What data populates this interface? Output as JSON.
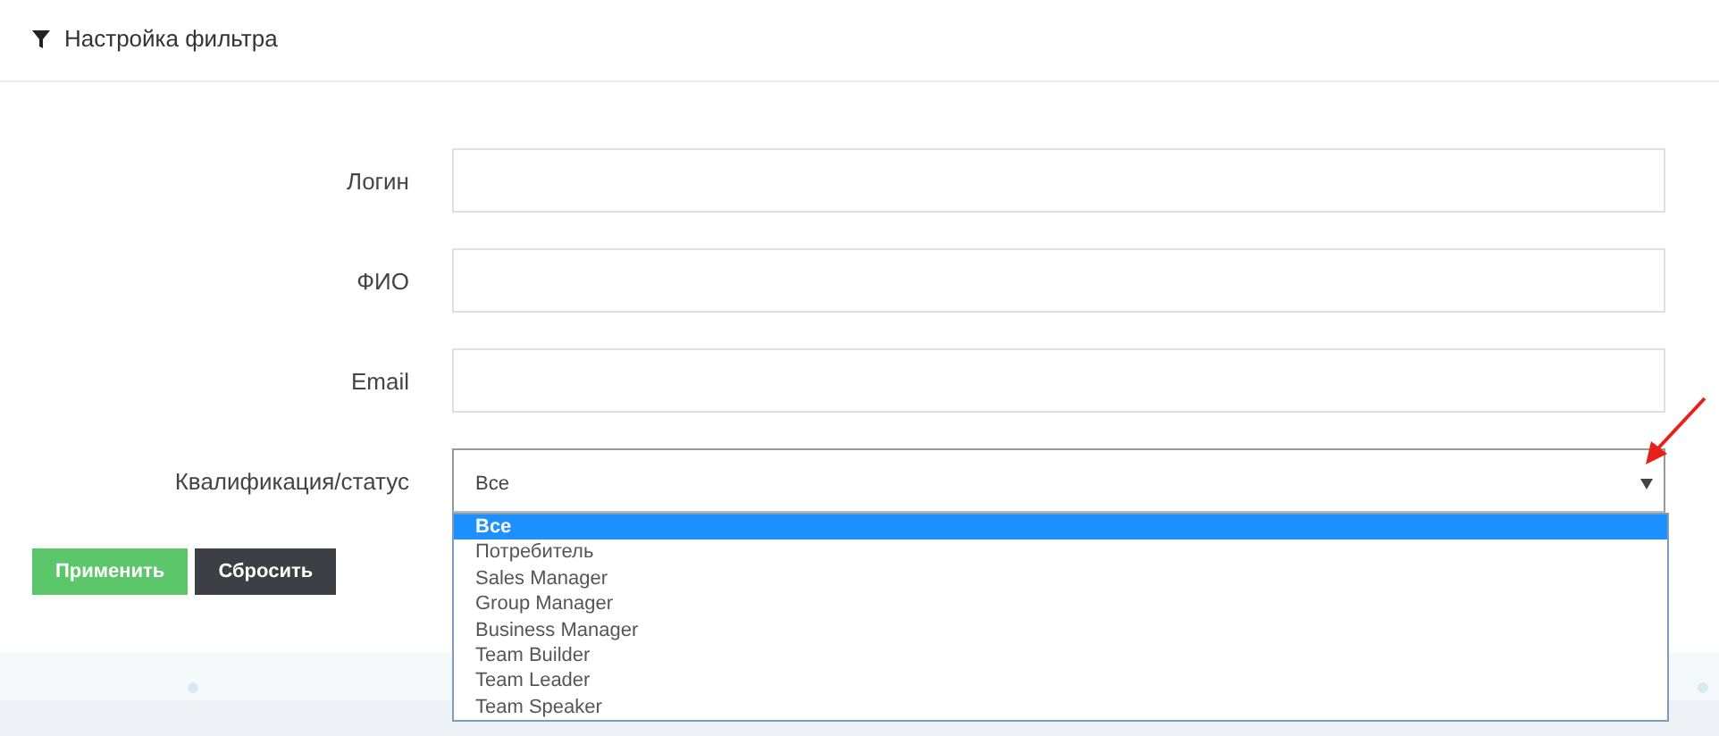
{
  "header": {
    "title": "Настройка фильтра"
  },
  "fields": [
    {
      "label": "Логин",
      "kind": "text"
    },
    {
      "label": "ФИО",
      "kind": "text"
    },
    {
      "label": "Email",
      "kind": "text"
    },
    {
      "label": "Квалификация/статус",
      "kind": "select",
      "value": "Все",
      "expanded": true,
      "options": [
        {
          "label": "Все",
          "selected": true
        },
        {
          "label": "Потребитель",
          "selected": false
        },
        {
          "label": "Sales Manager",
          "selected": false
        },
        {
          "label": "Group Manager",
          "selected": false
        },
        {
          "label": "Business Manager",
          "selected": false
        },
        {
          "label": "Team Builder",
          "selected": false
        },
        {
          "label": "Team Leader",
          "selected": false
        },
        {
          "label": "Team Speaker",
          "selected": false
        }
      ]
    }
  ],
  "buttons": [
    {
      "label": "Применить",
      "kind": "primary"
    },
    {
      "label": "Сбросить",
      "kind": "secondary"
    }
  ]
}
